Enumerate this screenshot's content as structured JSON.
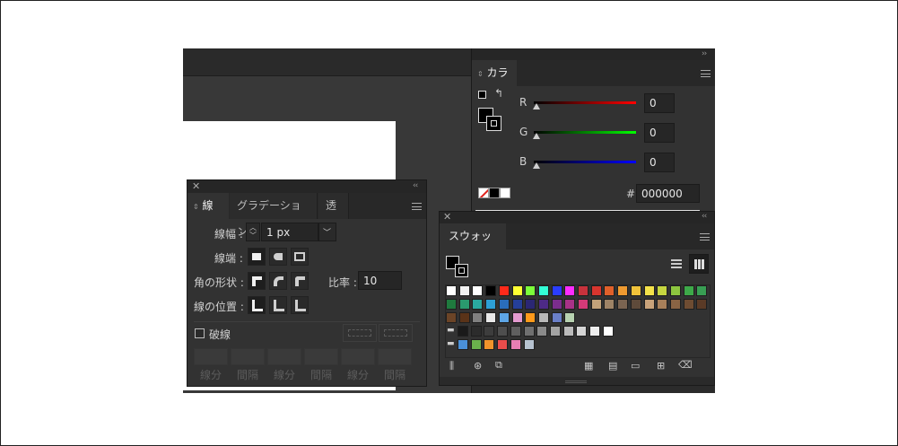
{
  "dock": {
    "collapse_glyph": "››",
    "expand_glyph": "‹‹",
    "close_glyph": "✕"
  },
  "color_panel": {
    "tab_label": "カラー",
    "channels": [
      {
        "label": "R",
        "value": "0",
        "gradient_end": "#ff0000"
      },
      {
        "label": "G",
        "value": "0",
        "gradient_end": "#00ff00"
      },
      {
        "label": "B",
        "value": "0",
        "gradient_end": "#0000ff"
      }
    ],
    "hex_label": "#",
    "hex_value": "000000",
    "swap_glyph": "↰"
  },
  "stroke_panel": {
    "tabs": [
      {
        "label": "線"
      },
      {
        "label": "グラデーション"
      },
      {
        "label": "透明"
      }
    ],
    "weight_label": "線幅 :",
    "weight_value": "1 px",
    "cap_label": "線端 :",
    "corner_label": "角の形状 :",
    "ratio_label": "比率 :",
    "ratio_value": "10",
    "align_label": "線の位置 :",
    "dashed_label": "破線",
    "dash_labels": [
      "線分",
      "間隔",
      "線分",
      "間隔",
      "線分",
      "間隔"
    ]
  },
  "swatches_panel": {
    "tab_label": "スウォッチ",
    "rows": [
      [
        "#ffffff",
        "#f0f0f0",
        "#ffffff",
        "#000000",
        "#ff2a1a",
        "#ffff33",
        "#7cff3a",
        "#33ffd6",
        "#2a3dff",
        "#ff2cff",
        "#c8323c",
        "#d8352e",
        "#e0602a",
        "#ef9a30",
        "#f0c23a",
        "#f4e24a",
        "#c6d640",
        "#8dc63f",
        "#3da949",
        "#389e53"
      ],
      [
        "#1f7a3e",
        "#2a9a6e",
        "#2aa8a0",
        "#2d9fd6",
        "#2a6dba",
        "#253f9a",
        "#2b2774",
        "#4d2a87",
        "#7b2d8c",
        "#a83287",
        "#d43a78",
        "#c2a27a",
        "#9e8366",
        "#7b6451",
        "#5e4a3a",
        "#c8a27a",
        "#a8805a",
        "#8a6444",
        "#6e4c32",
        "#5a3a26"
      ],
      [
        "#6b4427",
        "#5a3318",
        "#808080",
        "#e9e9e9",
        "#5ea6e6",
        "#e49bd0",
        "#ff9a1a",
        "#b9b9b9",
        "#6a7fc8",
        "#b7d2b0"
      ],
      [
        "#1a1a1a",
        "#2c2c2c",
        "#3d3d3d",
        "#4e4e4e",
        "#5f5f5f",
        "#707070",
        "#8a8a8a",
        "#a3a3a3",
        "#bcbcbc",
        "#d5d5d5",
        "#eeeeee",
        "#ffffff"
      ],
      [
        "#4a90d9",
        "#6ab04c",
        "#f0932b",
        "#eb4d4b",
        "#e77fb3",
        "#b6c2d0"
      ]
    ]
  }
}
